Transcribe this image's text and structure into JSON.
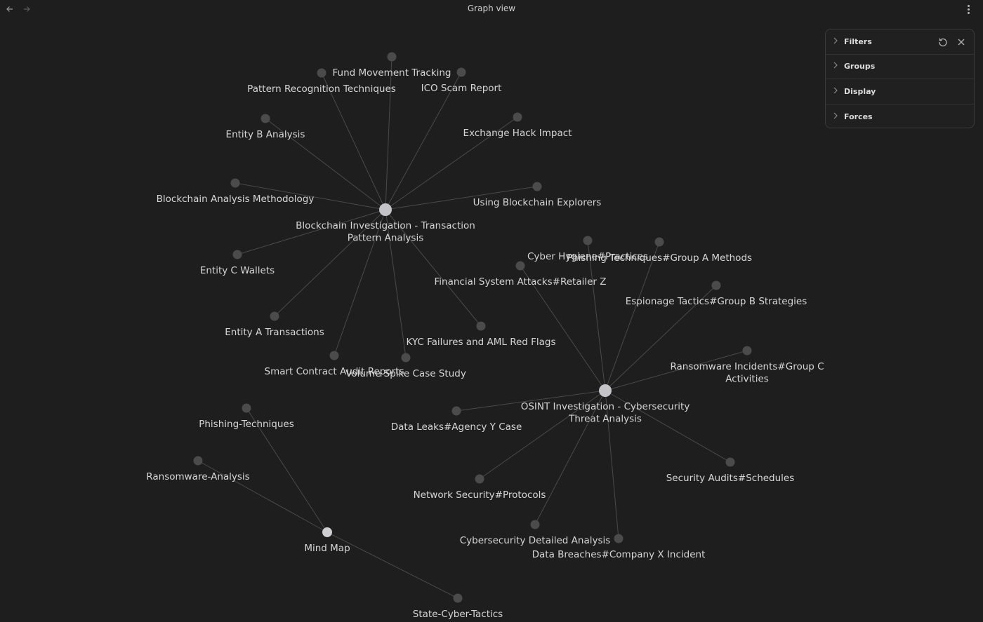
{
  "header": {
    "title": "Graph view"
  },
  "panel": {
    "sections": [
      {
        "label": "Filters"
      },
      {
        "label": "Groups"
      },
      {
        "label": "Display"
      },
      {
        "label": "Forces"
      }
    ]
  },
  "graph": {
    "nodes": [
      {
        "id": "blockchain",
        "label": [
          "Blockchain Investigation - Transaction",
          "Pattern Analysis"
        ],
        "kind": "hub"
      },
      {
        "id": "osint",
        "label": [
          "OSINT Investigation - Cybersecurity",
          "Threat Analysis"
        ],
        "kind": "hub"
      },
      {
        "id": "mindmap",
        "label": [
          "Mind Map"
        ],
        "kind": "hub-small"
      },
      {
        "id": "fund",
        "label": [
          "Fund Movement Tracking"
        ],
        "kind": "leaf"
      },
      {
        "id": "pattern",
        "label": [
          "Pattern Recognition Techniques"
        ],
        "kind": "leaf"
      },
      {
        "id": "ico",
        "label": [
          "ICO Scam Report"
        ],
        "kind": "leaf"
      },
      {
        "id": "entityb",
        "label": [
          "Entity B Analysis"
        ],
        "kind": "leaf"
      },
      {
        "id": "exchange",
        "label": [
          "Exchange Hack Impact"
        ],
        "kind": "leaf"
      },
      {
        "id": "method",
        "label": [
          "Blockchain Analysis Methodology"
        ],
        "kind": "leaf"
      },
      {
        "id": "explorers",
        "label": [
          "Using Blockchain Explorers"
        ],
        "kind": "leaf"
      },
      {
        "id": "entityc",
        "label": [
          "Entity C Wallets"
        ],
        "kind": "leaf"
      },
      {
        "id": "entitya",
        "label": [
          "Entity A Transactions"
        ],
        "kind": "leaf"
      },
      {
        "id": "smart",
        "label": [
          "Smart Contract Audit Reports"
        ],
        "kind": "leaf"
      },
      {
        "id": "volume",
        "label": [
          "Volume Spike Case Study"
        ],
        "kind": "leaf"
      },
      {
        "id": "kyc",
        "label": [
          "KYC Failures and AML Red Flags"
        ],
        "kind": "leaf"
      },
      {
        "id": "financial",
        "label": [
          "Financial System Attacks#Retailer Z"
        ],
        "kind": "leaf"
      },
      {
        "id": "hygiene",
        "label": [
          "Cyber Hygiene#Practices"
        ],
        "kind": "leaf"
      },
      {
        "id": "phishingA",
        "label": [
          "Phishing Techniques#Group A Methods"
        ],
        "kind": "leaf"
      },
      {
        "id": "espionage",
        "label": [
          "Espionage Tactics#Group B Strategies"
        ],
        "kind": "leaf"
      },
      {
        "id": "ransomC",
        "label": [
          "Ransomware Incidents#Group C",
          "Activities"
        ],
        "kind": "leaf"
      },
      {
        "id": "leaks",
        "label": [
          "Data Leaks#Agency Y Case"
        ],
        "kind": "leaf"
      },
      {
        "id": "audits",
        "label": [
          "Security Audits#Schedules"
        ],
        "kind": "leaf"
      },
      {
        "id": "netsec",
        "label": [
          "Network Security#Protocols"
        ],
        "kind": "leaf"
      },
      {
        "id": "cyberdet",
        "label": [
          "Cybersecurity Detailed Analysis"
        ],
        "kind": "leaf"
      },
      {
        "id": "breaches",
        "label": [
          "Data Breaches#Company X Incident"
        ],
        "kind": "leaf"
      },
      {
        "id": "phishing",
        "label": [
          "Phishing-Techniques"
        ],
        "kind": "leaf"
      },
      {
        "id": "ransomware",
        "label": [
          "Ransomware-Analysis"
        ],
        "kind": "leaf"
      },
      {
        "id": "statecyber",
        "label": [
          "State-Cyber-Tactics"
        ],
        "kind": "leaf"
      }
    ],
    "edges": [
      [
        "blockchain",
        "fund"
      ],
      [
        "blockchain",
        "pattern"
      ],
      [
        "blockchain",
        "ico"
      ],
      [
        "blockchain",
        "entityb"
      ],
      [
        "blockchain",
        "exchange"
      ],
      [
        "blockchain",
        "method"
      ],
      [
        "blockchain",
        "explorers"
      ],
      [
        "blockchain",
        "entityc"
      ],
      [
        "blockchain",
        "entitya"
      ],
      [
        "blockchain",
        "smart"
      ],
      [
        "blockchain",
        "volume"
      ],
      [
        "blockchain",
        "kyc"
      ],
      [
        "osint",
        "financial"
      ],
      [
        "osint",
        "hygiene"
      ],
      [
        "osint",
        "phishingA"
      ],
      [
        "osint",
        "espionage"
      ],
      [
        "osint",
        "ransomC"
      ],
      [
        "osint",
        "leaks"
      ],
      [
        "osint",
        "audits"
      ],
      [
        "osint",
        "netsec"
      ],
      [
        "osint",
        "cyberdet"
      ],
      [
        "osint",
        "breaches"
      ],
      [
        "mindmap",
        "phishing"
      ],
      [
        "mindmap",
        "ransomware"
      ],
      [
        "mindmap",
        "statecyber"
      ]
    ]
  }
}
